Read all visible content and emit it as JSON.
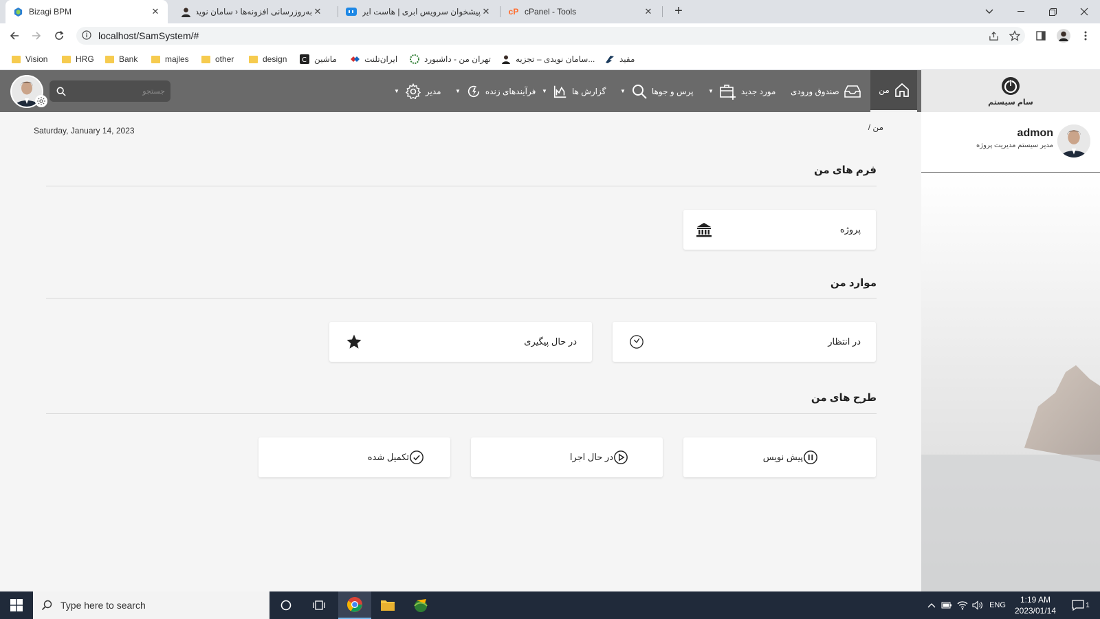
{
  "browser": {
    "tabs": [
      {
        "title": "Bizagi BPM",
        "active": true
      },
      {
        "title": "به‌روزرسانی افزونه‌ها ‹ سامان نویدی",
        "active": false
      },
      {
        "title": "پیشخوان سرویس ابری | هاست ایران",
        "active": false
      },
      {
        "title": "cPanel - Tools",
        "active": false
      }
    ],
    "new_tab": "+",
    "url": "localhost/SamSystem/#",
    "bookmarks": [
      {
        "label": "Vision",
        "icon": "folder-icon"
      },
      {
        "label": "HRG",
        "icon": "folder-icon"
      },
      {
        "label": "Bank",
        "icon": "folder-icon"
      },
      {
        "label": "majles",
        "icon": "folder-icon"
      },
      {
        "label": "other",
        "icon": "folder-icon"
      },
      {
        "label": "design",
        "icon": "folder-icon"
      },
      {
        "label": "ماشین",
        "icon": "site-icon"
      },
      {
        "label": "ایران‌تلنت",
        "icon": "site-icon"
      },
      {
        "label": "تهران من - داشبورد",
        "icon": "site-icon"
      },
      {
        "label": "سامان نویدی – تجزیه...",
        "icon": "avatar-icon"
      },
      {
        "label": "مفید",
        "icon": "site-icon"
      }
    ]
  },
  "app": {
    "nav": {
      "home": "من",
      "inbox": "صندوق ورودی",
      "new_case": "مورد جدید",
      "queries": "پرس و جوها",
      "reports": "گزارش ها",
      "live_processes": "فرآیندهای زنده",
      "admin": "مدیر",
      "search_placeholder": "جستجو"
    },
    "brand": {
      "name": "سام سیستم"
    },
    "profile": {
      "name": "admon",
      "role": "مدیر سیستم مدیریت پروژه"
    },
    "date": "Saturday, January 14, 2023",
    "breadcrumb": "من /",
    "sections": {
      "my_forms": {
        "title": "فرم های من",
        "cards": [
          {
            "label": "پروژه",
            "icon": "bank-icon"
          }
        ]
      },
      "my_items": {
        "title": "موارد من",
        "cards": [
          {
            "label": "در انتظار",
            "icon": "clock-icon"
          },
          {
            "label": "در حال پیگیری",
            "icon": "star-icon"
          }
        ]
      },
      "my_plans": {
        "title": "طرح های من",
        "cards": [
          {
            "label": "پیش نویس",
            "icon": "pause-circle-icon"
          },
          {
            "label": "در حال اجرا",
            "icon": "play-circle-icon"
          },
          {
            "label": "تکمیل شده",
            "icon": "check-circle-icon"
          }
        ]
      }
    }
  },
  "taskbar": {
    "search_placeholder": "Type here to search",
    "language": "ENG",
    "time": "1:19 AM",
    "date": "2023/01/14",
    "notifications": "1"
  },
  "colors": {
    "nav_bg": "#6a6a6a",
    "nav_active": "#4d4d4d",
    "content_bg": "#f5f5f5",
    "taskbar_bg": "#202a3a"
  }
}
